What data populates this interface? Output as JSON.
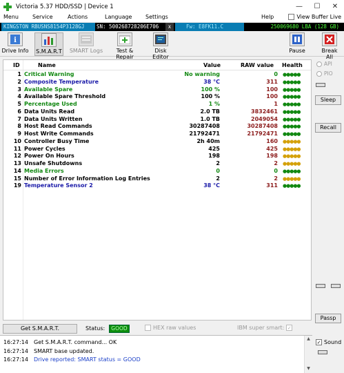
{
  "window": {
    "title": "Victoria 5.37 HDD/SSD | Device 1",
    "min_glyph": "—",
    "max_glyph": "☐",
    "close_glyph": "✕"
  },
  "menu": {
    "items": [
      "Menu",
      "Service",
      "Actions",
      "Language",
      "Settings",
      "Help"
    ],
    "view_buffer_label": "View Buffer Live",
    "view_buffer_checked": false
  },
  "device": {
    "model": "KINGSTON RBUSNS8154P3128GJ",
    "serial": "SN: 500268728206E706",
    "x_label": "x",
    "firmware": "Fw: E8FK11.C",
    "lba": "250069680 LBA (128 GB)"
  },
  "toolbar": {
    "drive_info": "Drive Info",
    "smart": "S.M.A.R.T",
    "smart_logs": "SMART Logs",
    "test_repair": "Test & Repair",
    "disk_editor": "Disk Editor",
    "pause": "Pause",
    "break_all": "Break All"
  },
  "smart_table": {
    "headers": {
      "id": "ID",
      "name": "Name",
      "value": "Value",
      "raw": "RAW value",
      "health": "Health"
    },
    "rows": [
      {
        "id": "1",
        "name": "Critical Warning",
        "value": "No warning",
        "raw": "0",
        "health": "●●●●●",
        "name_color": "#118811",
        "value_color": "#118811",
        "raw_color": "#118811",
        "health_color": "#118811"
      },
      {
        "id": "2",
        "name": "Composite Temperature",
        "value": "38 °C",
        "raw": "311",
        "health": "●●●●●",
        "name_color": "#1a1aa8",
        "value_color": "#1a1aa8",
        "raw_color": "#8b1a1a",
        "health_color": "#118811"
      },
      {
        "id": "3",
        "name": "Available Spare",
        "value": "100 %",
        "raw": "100",
        "health": "●●●●●",
        "name_color": "#118811",
        "value_color": "#118811",
        "raw_color": "#8b1a1a",
        "health_color": "#118811"
      },
      {
        "id": "4",
        "name": "Available Spare Threshold",
        "value": "100 %",
        "raw": "100",
        "health": "●●●●●",
        "name_color": "#000000",
        "value_color": "#000000",
        "raw_color": "#8b1a1a",
        "health_color": "#118811"
      },
      {
        "id": "5",
        "name": "Percentage Used",
        "value": "1 %",
        "raw": "1",
        "health": "●●●●●",
        "name_color": "#118811",
        "value_color": "#118811",
        "raw_color": "#8b1a1a",
        "health_color": "#118811"
      },
      {
        "id": "6",
        "name": "Data Units Read",
        "value": "2.0 TB",
        "raw": "3832461",
        "health": "●●●●●",
        "name_color": "#000000",
        "value_color": "#000000",
        "raw_color": "#8b1a1a",
        "health_color": "#118811"
      },
      {
        "id": "7",
        "name": "Data Units Written",
        "value": "1.0 TB",
        "raw": "2049054",
        "health": "●●●●●",
        "name_color": "#000000",
        "value_color": "#000000",
        "raw_color": "#8b1a1a",
        "health_color": "#118811"
      },
      {
        "id": "8",
        "name": "Host Read Commands",
        "value": "30287408",
        "raw": "30287408",
        "health": "●●●●●",
        "name_color": "#000000",
        "value_color": "#000000",
        "raw_color": "#8b1a1a",
        "health_color": "#118811"
      },
      {
        "id": "9",
        "name": "Host Write Commands",
        "value": "21792471",
        "raw": "21792471",
        "health": "●●●●●",
        "name_color": "#000000",
        "value_color": "#000000",
        "raw_color": "#8b1a1a",
        "health_color": "#118811"
      },
      {
        "id": "10",
        "name": "Controller Busy Time",
        "value": "2h 40m",
        "raw": "160",
        "health": "●●●●●",
        "name_color": "#000000",
        "value_color": "#000000",
        "raw_color": "#8b1a1a",
        "health_color": "#d4a10a"
      },
      {
        "id": "11",
        "name": "Power Cycles",
        "value": "425",
        "raw": "425",
        "health": "●●●●●",
        "name_color": "#000000",
        "value_color": "#000000",
        "raw_color": "#8b1a1a",
        "health_color": "#d4a10a"
      },
      {
        "id": "12",
        "name": "Power On Hours",
        "value": "198",
        "raw": "198",
        "health": "●●●●●",
        "name_color": "#000000",
        "value_color": "#000000",
        "raw_color": "#8b1a1a",
        "health_color": "#d4a10a"
      },
      {
        "id": "13",
        "name": "Unsafe Shutdowns",
        "value": "2",
        "raw": "2",
        "health": "●●●●●",
        "name_color": "#000000",
        "value_color": "#000000",
        "raw_color": "#8b1a1a",
        "health_color": "#d4a10a"
      },
      {
        "id": "14",
        "name": "Media Errors",
        "value": "0",
        "raw": "0",
        "health": "●●●●●",
        "name_color": "#118811",
        "value_color": "#118811",
        "raw_color": "#118811",
        "health_color": "#118811"
      },
      {
        "id": "15",
        "name": "Number of Error Information Log Entries",
        "value": "2",
        "raw": "2",
        "health": "●●●●●",
        "name_color": "#000000",
        "value_color": "#000000",
        "raw_color": "#8b1a1a",
        "health_color": "#d4a10a"
      },
      {
        "id": "19",
        "name": "Temperature Sensor 2",
        "value": "38 °C",
        "raw": "311",
        "health": "●●●●●",
        "name_color": "#1a1aa8",
        "value_color": "#1a1aa8",
        "raw_color": "#8b1a1a",
        "health_color": "#118811"
      }
    ]
  },
  "right_panel": {
    "api_label": "API",
    "pio_label": "PIO",
    "sleep_label": "Sleep",
    "recall_label": "Recall",
    "passp_label": "Passp"
  },
  "status": {
    "get_smart_label": "Get S.M.A.R.T.",
    "status_label": "Status:",
    "status_value": "GOOD",
    "hex_raw_label": "HEX raw values",
    "ibm_label": "IBM super smart:",
    "ibm_checked_glyph": "✓"
  },
  "log": {
    "lines": [
      {
        "time": "16:27:14",
        "msg": "Get S.M.A.R.T. command... OK",
        "color": "#000000"
      },
      {
        "time": "16:27:14",
        "msg": "SMART base updated.",
        "color": "#000000"
      },
      {
        "time": "16:27:14",
        "msg": "Drive reported: SMART status = GOOD",
        "color": "#1a3fc8"
      }
    ]
  },
  "sound": {
    "label": "Sound",
    "checked_glyph": "✓"
  },
  "icons": {
    "drive_info": "info-icon",
    "smart": "smart-chart-icon",
    "smart_logs": "log-icon",
    "test_repair": "medkit-icon",
    "disk_editor": "disk-editor-icon",
    "pause": "pause-icon",
    "break_all": "break-all-icon"
  }
}
